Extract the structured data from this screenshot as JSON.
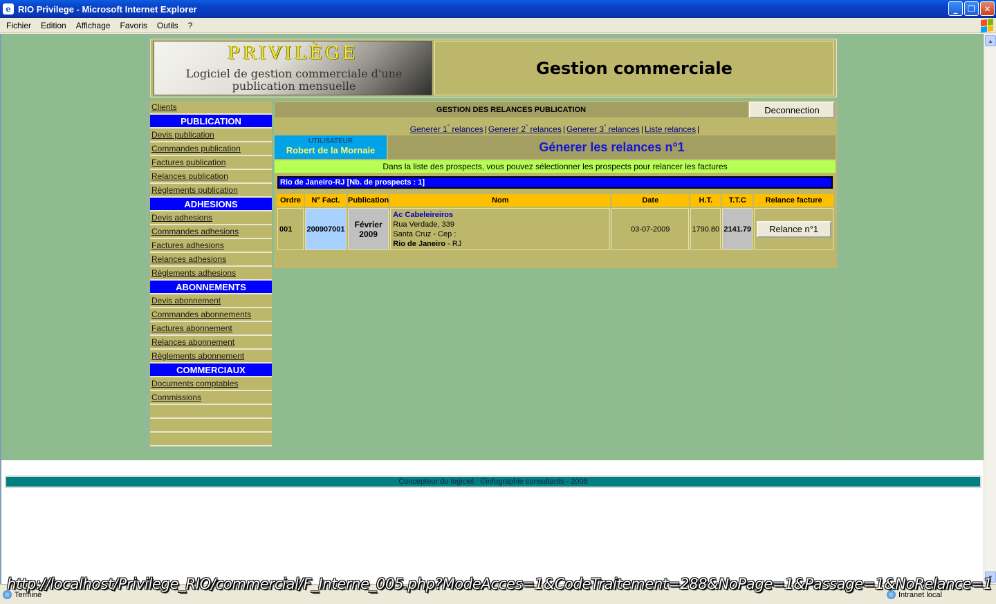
{
  "window": {
    "title": "RIO Privilege - Microsoft Internet Explorer",
    "buttons": {
      "minimize": "_",
      "maximize": "❐",
      "close": "✕"
    }
  },
  "menubar": {
    "items": [
      "Fichier",
      "Edition",
      "Affichage",
      "Favoris",
      "Outils",
      "?"
    ]
  },
  "header": {
    "logo_brand": "PRIVILÈGE",
    "logo_tagline": "Logiciel de gestion commerciale d'une publication mensuelle",
    "title": "Gestion commerciale"
  },
  "nav": {
    "items": [
      {
        "label": "Clients",
        "type": "link"
      },
      {
        "label": "PUBLICATION",
        "type": "section"
      },
      {
        "label": "Devis publication",
        "type": "link"
      },
      {
        "label": "Commandes publication",
        "type": "link"
      },
      {
        "label": "Factures publication",
        "type": "link"
      },
      {
        "label": "Relances publication",
        "type": "link"
      },
      {
        "label": "Règlements publication",
        "type": "link"
      },
      {
        "label": "ADHESIONS",
        "type": "section"
      },
      {
        "label": "Devis adhesions",
        "type": "link"
      },
      {
        "label": "Commandes adhesions",
        "type": "link"
      },
      {
        "label": "Factures adhesions",
        "type": "link"
      },
      {
        "label": "Relances adhesions",
        "type": "link"
      },
      {
        "label": "Règlements adhesions",
        "type": "link"
      },
      {
        "label": "ABONNEMENTS",
        "type": "section"
      },
      {
        "label": "Devis abonnement",
        "type": "link"
      },
      {
        "label": "Commandes abonnements",
        "type": "link"
      },
      {
        "label": "Factures abonnement",
        "type": "link"
      },
      {
        "label": "Relances abonnement",
        "type": "link"
      },
      {
        "label": "Règlements abonnement",
        "type": "link"
      },
      {
        "label": "COMMERCIAUX",
        "type": "section"
      },
      {
        "label": "Documents comptables",
        "type": "link"
      },
      {
        "label": "Commissions",
        "type": "link"
      },
      {
        "label": "",
        "type": "empty"
      },
      {
        "label": "",
        "type": "empty"
      },
      {
        "label": "",
        "type": "empty"
      }
    ]
  },
  "main": {
    "section_title": "GESTION DES RELANCES PUBLICATION",
    "logout_label": "Deconnection",
    "links": [
      {
        "pre": "Generer ",
        "num": "1",
        "sup": "°",
        "post": " relances"
      },
      {
        "pre": "Generer ",
        "num": "2",
        "sup": "°",
        "post": " relances"
      },
      {
        "pre": "Generer ",
        "num": "3",
        "sup": "°",
        "post": " relances"
      },
      {
        "pre": "Liste relances",
        "num": "",
        "sup": "",
        "post": ""
      }
    ],
    "separator": "|",
    "user_label": "UTILISATEUR",
    "user_name": "Robert de la Mornaie",
    "page_title": "Génerer les relances n°1",
    "info": "Dans la liste des prospects, vous pouvez sélectionner les prospects pour relancer les factures",
    "region_header": "Rio de Janeiro-RJ [Nb. de prospects : 1]",
    "columns": [
      "Ordre",
      "N° Fact.",
      "Publication",
      "Nom",
      "Date",
      "H.T.",
      "T.T.C",
      "Relance facture"
    ],
    "rows": [
      {
        "ordre": "001",
        "fact": "200907001",
        "pub_month": "Février",
        "pub_year": "2009",
        "name": "Ac Cabeleireiros",
        "addr1": "Rua Verdade, 339",
        "addr2": "Santa Cruz - Cep :",
        "city": "Rio de Janeiro",
        "state": " - RJ",
        "date": "03-07-2009",
        "ht": "1790.80",
        "ttc": "2141.79",
        "action": "Relance n°1"
      }
    ]
  },
  "footer": {
    "text": "Concepteur du logiciel : ©infographie consultants - 2008"
  },
  "statusbar": {
    "left": "Terminé",
    "right": "Intranet local",
    "url_overlay": "http://localhost/Privilege_RIO/commercial/F_Interne_005.php?ModeAcces=1&CodeTraitement=288&NoPage=1&Passage=1&NoRelance=1"
  },
  "colors": {
    "olive": "#bdb76b",
    "section_blue": "#0000ff",
    "header_orange": "#ffc000",
    "info_green": "#b8ff55",
    "page_green": "#8fbc8f",
    "footer_teal": "#008080"
  },
  "icons": {
    "app": "ie-icon",
    "status": "globe-icon",
    "zone": "computer-icon",
    "brand": "windows-flag-icon"
  }
}
